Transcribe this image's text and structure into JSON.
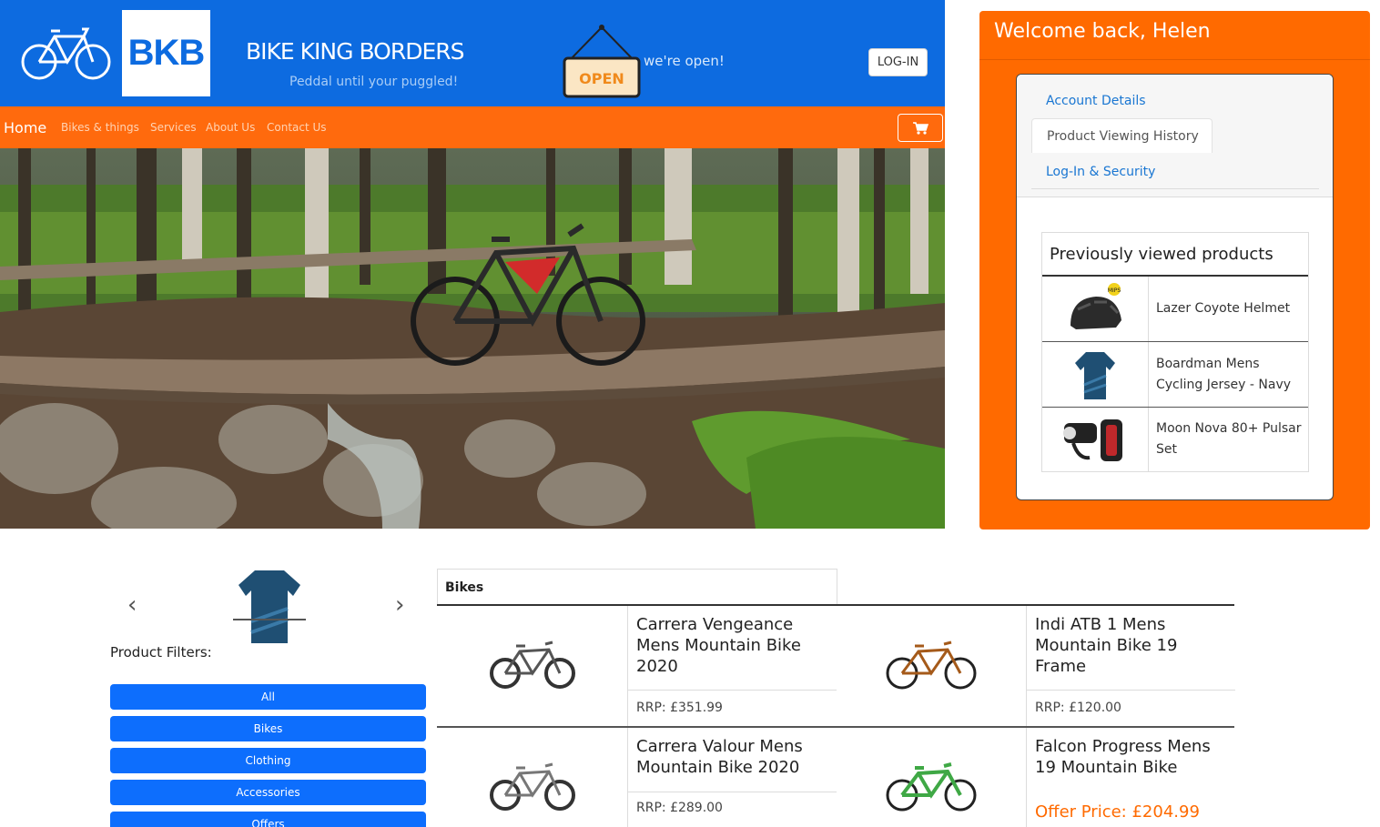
{
  "header": {
    "logo_text": "BKB",
    "brand_name": "BIKE KING BORDERS",
    "tagline": "Peddal until your puggled!",
    "sign_text": "OPEN",
    "open_status": "we're open!",
    "login_label": "LOG-IN"
  },
  "nav": {
    "items": [
      "Home",
      "Bikes & things",
      "Services",
      "About Us",
      "Contact Us"
    ],
    "active": "Home",
    "cart_icon": "cart-icon"
  },
  "account": {
    "welcome": "Welcome back, Helen",
    "tabs": [
      "Account Details",
      "Product Viewing History",
      "Log-In & Security"
    ],
    "active_tab": "Product Viewing History",
    "previous_title": "Previously viewed products",
    "previous_products": [
      {
        "name": "Lazer Coyote Helmet",
        "badge": "MIPS"
      },
      {
        "name": "Boardman Mens Cycling Jersey - Navy"
      },
      {
        "name": "Moon Nova 80+ Pulsar Set"
      }
    ]
  },
  "shop": {
    "filters_title": "Product Filters:",
    "filters": [
      "All",
      "Bikes",
      "Clothing",
      "Accessories",
      "Offers"
    ],
    "category_title": "Bikes",
    "products": [
      {
        "name": "Carrera Vengeance Mens Mountain Bike 2020",
        "price": "RRP: £351.99"
      },
      {
        "name": "Indi ATB 1 Mens Mountain Bike 19 Frame",
        "price": "RRP: £120.00"
      },
      {
        "name": "Carrera Valour Mens Mountain Bike 2020",
        "price": "RRP: £289.00"
      },
      {
        "name": "Falcon Progress Mens 19 Mountain Bike",
        "price": "Offer Price: £204.99"
      }
    ]
  },
  "colors": {
    "brand_blue": "#0d6be0",
    "brand_orange": "#ff6a00",
    "button_blue": "#0d6efd"
  }
}
